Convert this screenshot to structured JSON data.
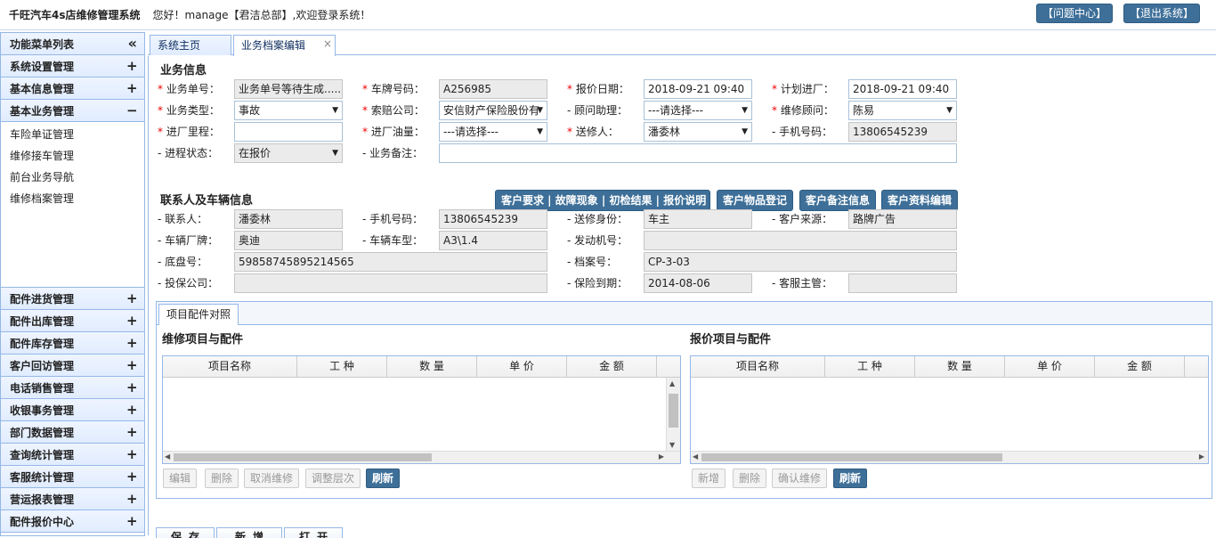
{
  "header": {
    "title": "千旺汽车4s店维修管理系统",
    "welcome": "您好！manage【君洁总部】,欢迎登录系统！",
    "help_btn": "【问题中心】",
    "logout_btn": "【退出系统】"
  },
  "sidebar": {
    "title": "功能菜单列表",
    "collapse_icon": "«",
    "groups_top": [
      {
        "label": "系统设置管理",
        "sign": "+"
      },
      {
        "label": "基本信息管理",
        "sign": "+"
      },
      {
        "label": "基本业务管理",
        "sign": "−"
      }
    ],
    "subitems": [
      "车险单证管理",
      "维修接车管理",
      "前台业务导航",
      "维修档案管理"
    ],
    "groups_bottom": [
      {
        "label": "配件进货管理",
        "sign": "+"
      },
      {
        "label": "配件出库管理",
        "sign": "+"
      },
      {
        "label": "配件库存管理",
        "sign": "+"
      },
      {
        "label": "客户回访管理",
        "sign": "+"
      },
      {
        "label": "电话销售管理",
        "sign": "+"
      },
      {
        "label": "收银事务管理",
        "sign": "+"
      },
      {
        "label": "部门数据管理",
        "sign": "+"
      },
      {
        "label": "查询统计管理",
        "sign": "+"
      },
      {
        "label": "客服统计管理",
        "sign": "+"
      },
      {
        "label": "营运报表管理",
        "sign": "+"
      },
      {
        "label": "配件报价中心",
        "sign": "+"
      }
    ]
  },
  "tabs": {
    "home": "系统主页",
    "edit": "业务档案编辑",
    "close": "×"
  },
  "business": {
    "title": "业务信息",
    "order_no_label": "业务单号：",
    "order_no": "业务单号等待生成......",
    "plate_label": "车牌号码：",
    "plate": "A256985",
    "quote_date_label": "报价日期：",
    "quote_date": "2018-09-21 09:40",
    "plan_date_label": "计划进厂：",
    "plan_date": "2018-09-21 09:40",
    "type_label": "业务类型：",
    "type": "事故",
    "insurer_label": "索赔公司：",
    "insurer": "安信财产保险股份有",
    "assistant_label": "顾问助理：",
    "assistant": "---请选择---",
    "advisor_label": "维修顾问：",
    "advisor": "陈易",
    "mileage_label": "进厂里程：",
    "mileage": "",
    "fuel_label": "进厂油量：",
    "fuel": "---请选择---",
    "sender_label": "送修人：",
    "sender": "潘委林",
    "phone_label": "手机号码：",
    "phone": "13806545239",
    "status_label": "进程状态：",
    "status": "在报价",
    "remark_label": "业务备注：",
    "remark": "",
    "btn_requirements": "客户要求 | 故障现象 | 初检结果 | 报价说明",
    "btn_items": "客户物品登记",
    "btn_notes": "客户备注信息",
    "btn_profile": "客户资料编辑"
  },
  "contact": {
    "title": "联系人及车辆信息",
    "contact_label": "联系人：",
    "contact": "潘委林",
    "phone_label": "手机号码：",
    "phone": "13806545239",
    "identity_label": "送修身份：",
    "identity": "车主",
    "source_label": "客户来源：",
    "source": "路牌广告",
    "brand_label": "车辆厂牌：",
    "brand": "奥迪",
    "model_label": "车辆车型：",
    "model": "A3\\1.4",
    "engine_label": "发动机号：",
    "engine": "",
    "chassis_label": "底盘号：",
    "chassis": "59858745895214565",
    "archive_label": "档案号：",
    "archive": "CP-3-03",
    "ins_company_label": "投保公司：",
    "ins_company": "",
    "ins_expire_label": "保险到期：",
    "ins_expire": "2014-08-06",
    "cs_label": "客服主管：",
    "cs": ""
  },
  "parts": {
    "tab": "项目配件对照",
    "repair_title": "维修项目与配件",
    "quote_title": "报价项目与配件",
    "columns": [
      "项目名称",
      "工 种",
      "数 量",
      "单 价",
      "金 额"
    ],
    "repair_buttons": [
      "编辑",
      "删除",
      "取消维修",
      "调整层次",
      "刷新"
    ],
    "quote_buttons": [
      "新增",
      "删除",
      "确认维修",
      "刷新"
    ]
  },
  "footer": {
    "save": "保存",
    "new": "新增",
    "open": "打开"
  }
}
